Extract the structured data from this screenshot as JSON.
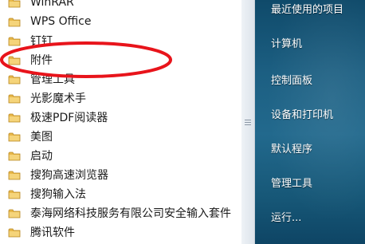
{
  "programs": [
    {
      "label": "WinRAR"
    },
    {
      "label": "WPS Office"
    },
    {
      "label": "钉钉"
    },
    {
      "label": "附件"
    },
    {
      "label": "管理工具"
    },
    {
      "label": "光影魔术手"
    },
    {
      "label": "极速PDF阅读器"
    },
    {
      "label": "美图"
    },
    {
      "label": "启动"
    },
    {
      "label": "搜狗高速浏览器"
    },
    {
      "label": "搜狗输入法"
    },
    {
      "label": "泰海网络科技服务有限公司安全输入套件"
    },
    {
      "label": "腾讯软件"
    }
  ],
  "right_menu": [
    {
      "label": "最近使用的项目"
    },
    {
      "label": "计算机"
    },
    {
      "label": "控制面板"
    },
    {
      "label": "设备和打印机"
    },
    {
      "label": "默认程序"
    },
    {
      "label": "管理工具"
    },
    {
      "label": "运行..."
    }
  ],
  "icons": {
    "folder": "folder-icon",
    "grip": "scroll-grip-icon"
  },
  "colors": {
    "annotation": "#e8141b",
    "panel": "#1c5f82",
    "folder": "#e8b84a"
  }
}
